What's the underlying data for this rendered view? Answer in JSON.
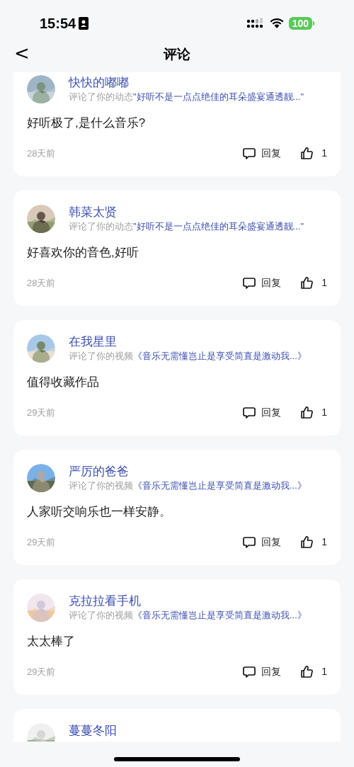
{
  "status_bar": {
    "time": "15:54",
    "battery": "100"
  },
  "nav": {
    "back": "<",
    "title": "评论"
  },
  "comments": [
    {
      "name": "快快的嘟嘟",
      "action": "评论了你的动态",
      "target": "\"好听不是一点点绝佳的耳朵盛宴通透靓...\"",
      "text": "好听极了,是什么音乐?",
      "time": "28天前",
      "reply": "回复",
      "likes": "1"
    },
    {
      "name": "韩菜太贤",
      "action": "评论了你的动态",
      "target": "\"好听不是一点点绝佳的耳朵盛宴通透靓...\"",
      "text": "好喜欢你的音色,好听",
      "time": "28天前",
      "reply": "回复",
      "likes": "1"
    },
    {
      "name": "在我星里",
      "action": "评论了你的视频",
      "target": "《音乐无需懂岂止是享受简直是激动我...》",
      "text": "值得收藏作品",
      "time": "29天前",
      "reply": "回复",
      "likes": "1"
    },
    {
      "name": "严厉的爸爸",
      "action": "评论了你的视频",
      "target": "《音乐无需懂岂止是享受简直是激动我...》",
      "text": "人家听交响乐也一样安静。",
      "time": "29天前",
      "reply": "回复",
      "likes": "1"
    },
    {
      "name": "克拉拉看手机",
      "action": "评论了你的视频",
      "target": "《音乐无需懂岂止是享受简直是激动我...》",
      "text": "太太棒了",
      "time": "29天前",
      "reply": "回复",
      "likes": "1"
    },
    {
      "name": "蔓蔓冬阳"
    }
  ]
}
